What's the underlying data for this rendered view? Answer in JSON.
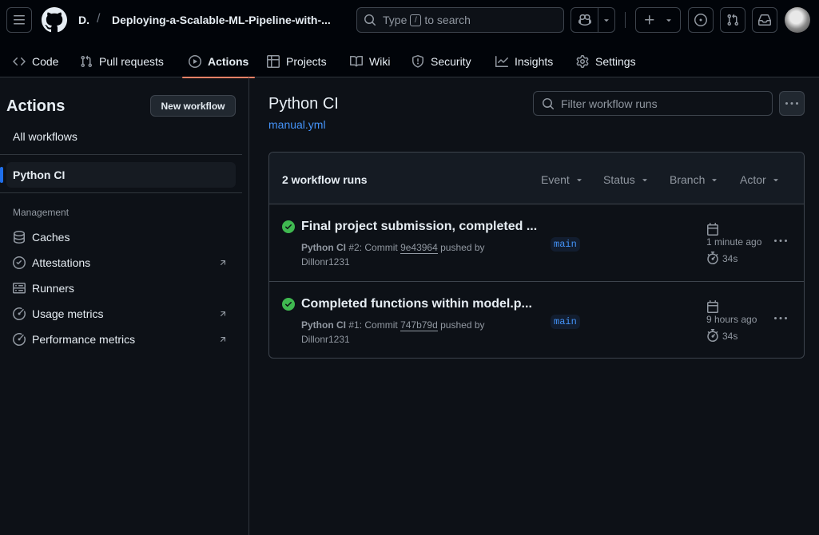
{
  "header": {
    "owner": "D.",
    "separator": "/",
    "repo": "Deploying-a-Scalable-ML-Pipeline-with-...",
    "search_pre": "Type",
    "search_key": "/",
    "search_post": "to search"
  },
  "nav": {
    "tabs": [
      {
        "label": "Code",
        "icon": "code-icon"
      },
      {
        "label": "Pull requests",
        "icon": "git-pull-request-icon"
      },
      {
        "label": "Actions",
        "icon": "play-icon",
        "active": true
      },
      {
        "label": "Projects",
        "icon": "table-icon"
      },
      {
        "label": "Wiki",
        "icon": "book-icon"
      },
      {
        "label": "Security",
        "icon": "shield-icon"
      },
      {
        "label": "Insights",
        "icon": "graph-icon"
      },
      {
        "label": "Settings",
        "icon": "gear-icon"
      }
    ]
  },
  "sidebar": {
    "title": "Actions",
    "new_workflow": "New workflow",
    "all_workflows": "All workflows",
    "selected_workflow": "Python CI",
    "management_heading": "Management",
    "management_items": [
      {
        "label": "Caches",
        "icon": "database-icon"
      },
      {
        "label": "Attestations",
        "icon": "verified-icon",
        "external": true
      },
      {
        "label": "Runners",
        "icon": "server-icon"
      },
      {
        "label": "Usage metrics",
        "icon": "meter-icon",
        "external": true
      },
      {
        "label": "Performance metrics",
        "icon": "meter-icon",
        "external": true
      }
    ]
  },
  "main": {
    "title": "Python CI",
    "file": "manual.yml",
    "filter_placeholder": "Filter workflow runs",
    "runs_count": "2 workflow runs",
    "filters": [
      "Event",
      "Status",
      "Branch",
      "Actor"
    ],
    "runs": [
      {
        "title": "Final project submission, completed ...",
        "workflow": "Python CI",
        "number": "#2",
        "commit_label": "Commit",
        "sha": "9e43964",
        "pushed_by": "pushed by",
        "author": "Dillonr1231",
        "branch": "main",
        "when": "1 minute ago",
        "duration": "34s",
        "status": "success"
      },
      {
        "title": "Completed functions within model.p...",
        "workflow": "Python CI",
        "number": "#1",
        "commit_label": "Commit",
        "sha": "747b79d",
        "pushed_by": "pushed by",
        "author": "Dillonr1231",
        "branch": "main",
        "when": "9 hours ago",
        "duration": "34s",
        "status": "success"
      }
    ]
  },
  "colors": {
    "bg": "#0d1117",
    "header_bg": "#010409",
    "border": "#30363d",
    "accent_tab": "#f78166",
    "link": "#4493f8",
    "success": "#3fb950"
  }
}
